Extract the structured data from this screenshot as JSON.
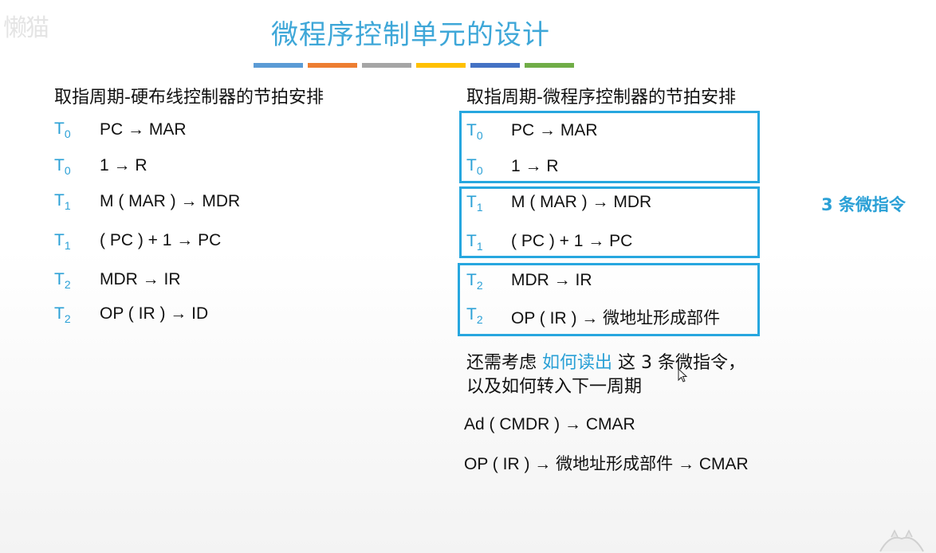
{
  "watermark": "懒猫",
  "title": "微程序控制单元的设计",
  "colors": [
    "#5b9bd5",
    "#ed7d31",
    "#a5a5a5",
    "#ffc000",
    "#4472c4",
    "#70ad47"
  ],
  "left": {
    "heading": "取指周期-硬布线控制器的节拍安排",
    "steps": [
      {
        "t": "T",
        "sub": "0",
        "src": "PC",
        "dst": "MAR"
      },
      {
        "t": "T",
        "sub": "0",
        "src": "1",
        "dst": "R"
      },
      {
        "t": "T",
        "sub": "1",
        "src": "M ( MAR )",
        "dst": "MDR"
      },
      {
        "t": "T",
        "sub": "1",
        "src": "( PC ) + 1",
        "dst": "PC"
      },
      {
        "t": "T",
        "sub": "2",
        "src": "MDR",
        "dst": "IR"
      },
      {
        "t": "T",
        "sub": "2",
        "src": "OP ( IR )",
        "dst": "ID"
      }
    ]
  },
  "right": {
    "heading": "取指周期-微程序控制器的节拍安排",
    "steps": [
      {
        "t": "T",
        "sub": "0",
        "src": "PC",
        "dst": "MAR"
      },
      {
        "t": "T",
        "sub": "0",
        "src": "1",
        "dst": "R"
      },
      {
        "t": "T",
        "sub": "1",
        "src": "M ( MAR )",
        "dst": "MDR"
      },
      {
        "t": "T",
        "sub": "1",
        "src": "( PC ) + 1",
        "dst": "PC"
      },
      {
        "t": "T",
        "sub": "2",
        "src": "MDR",
        "dst": "IR"
      },
      {
        "t": "T",
        "sub": "2",
        "src": "OP ( IR )",
        "dst": "微地址形成部件"
      }
    ],
    "note": "3 条微指令",
    "para1_a": "还需考虑 ",
    "para1_hl": "如何读出",
    "para1_b": " 这 3 条微指令，",
    "para2": "以及如何转入下一周期",
    "formula1_src": "Ad ( CMDR )",
    "formula1_dst": "CMAR",
    "formula2_src": "OP ( IR )",
    "formula2_mid": "微地址形成部件",
    "formula2_dst": "CMAR"
  },
  "arrow": "→"
}
